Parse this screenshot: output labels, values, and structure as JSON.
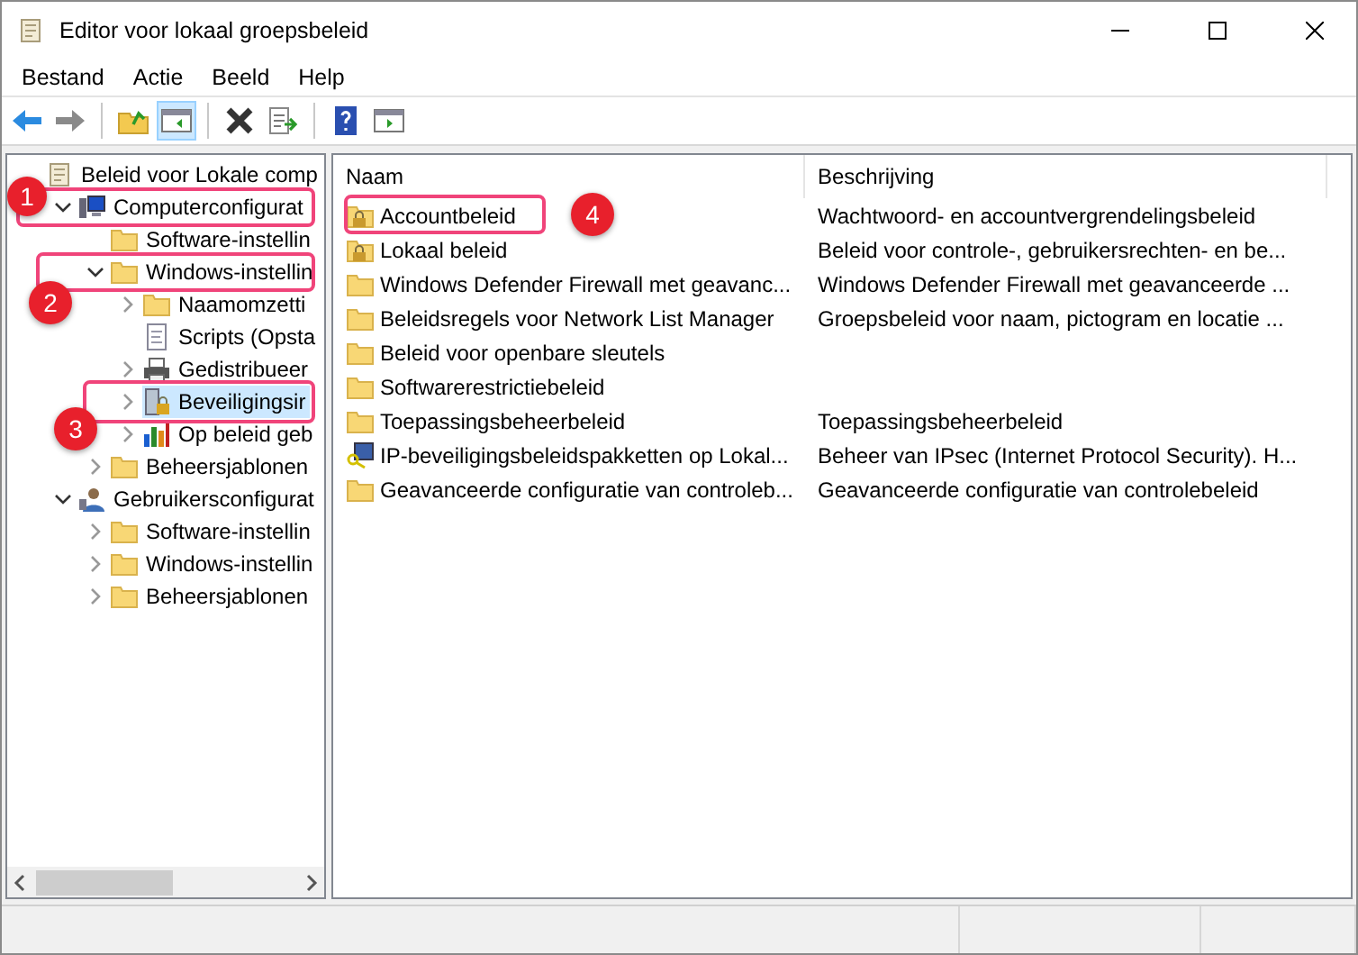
{
  "window": {
    "title": "Editor voor lokaal groepsbeleid"
  },
  "menu": [
    "Bestand",
    "Actie",
    "Beeld",
    "Help"
  ],
  "toolbar": [
    {
      "pressed": false
    },
    {
      "pressed": false
    },
    {
      "pressed": false
    },
    {
      "pressed": true
    },
    {
      "pressed": false
    },
    {
      "pressed": false
    },
    {
      "pressed": false
    },
    {
      "pressed": false
    }
  ],
  "tree": [
    {
      "label": "Beleid voor Lokale comp",
      "kind": "scroll",
      "selected": false,
      "children": [
        {
          "label": "Computerconfigurat",
          "kind": "computer",
          "expanded": true,
          "selected": false,
          "callout": "1",
          "children": [
            {
              "label": "Software-instellin",
              "kind": "folder",
              "selected": false
            },
            {
              "label": "Windows-instellin",
              "kind": "folder",
              "expanded": true,
              "selected": false,
              "callout": "2",
              "children": [
                {
                  "label": "Naamomzetti",
                  "kind": "folder",
                  "expanded": false,
                  "selected": false
                },
                {
                  "label": "Scripts (Opsta",
                  "kind": "script",
                  "selected": false
                },
                {
                  "label": "Gedistribueer",
                  "kind": "printer",
                  "expanded": false,
                  "selected": false
                },
                {
                  "label": "Beveiligingsir",
                  "kind": "security",
                  "expanded": false,
                  "selected": true,
                  "callout": "3"
                },
                {
                  "label": "Op beleid geb",
                  "kind": "chart",
                  "expanded": false,
                  "selected": false
                }
              ]
            },
            {
              "label": "Beheersjablonen",
              "kind": "folder",
              "expanded": false,
              "selected": false
            }
          ]
        },
        {
          "label": "Gebruikersconfigurat",
          "kind": "user",
          "expanded": true,
          "selected": false,
          "children": [
            {
              "label": "Software-instellin",
              "kind": "folder",
              "expanded": false,
              "selected": false
            },
            {
              "label": "Windows-instellin",
              "kind": "folder",
              "expanded": false,
              "selected": false
            },
            {
              "label": "Beheersjablonen",
              "kind": "folder",
              "expanded": false,
              "selected": false
            }
          ]
        }
      ]
    }
  ],
  "list": {
    "columns": [
      "Naam",
      "Beschrijving"
    ],
    "rows": [
      {
        "kind": "lockfolder",
        "name": "Accountbeleid",
        "description": "Wachtwoord- en accountvergrendelingsbeleid",
        "callout": "4"
      },
      {
        "kind": "lockfolder",
        "name": "Lokaal beleid",
        "description": "Beleid voor controle-, gebruikersrechten- en be..."
      },
      {
        "kind": "folder",
        "name": "Windows Defender Firewall met geavanc...",
        "description": "Windows Defender Firewall met geavanceerde ..."
      },
      {
        "kind": "folder",
        "name": "Beleidsregels voor Network List Manager",
        "description": "Groepsbeleid voor naam, pictogram en locatie ..."
      },
      {
        "kind": "folder",
        "name": "Beleid voor openbare sleutels"
      },
      {
        "kind": "folder",
        "name": "Softwarerestrictiebeleid"
      },
      {
        "kind": "folder",
        "name": "Toepassingsbeheerbeleid",
        "description": "Toepassingsbeheerbeleid"
      },
      {
        "kind": "ipsec",
        "name": "IP-beveiligingsbeleidspakketten op Lokal...",
        "description": "Beheer van IPsec (Internet Protocol Security). H..."
      },
      {
        "kind": "folder",
        "name": "Geavanceerde configuratie van controleb...",
        "description": "Geavanceerde configuratie van controlebeleid"
      }
    ]
  }
}
